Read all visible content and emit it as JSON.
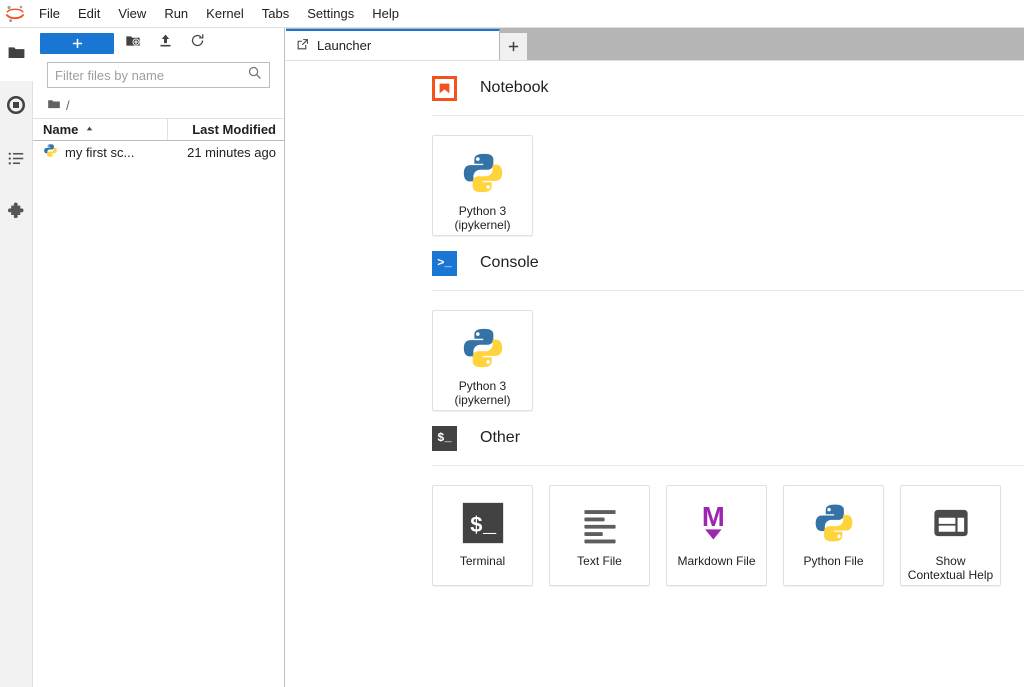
{
  "app": {
    "logo_icon": "jupyter-logo",
    "accent_blue": "#1976d2",
    "notebook_orange": "#f4511e",
    "markdown_purple": "#9c27b0",
    "tabbar_gray": "#b5b5b5"
  },
  "menubar": {
    "items": [
      {
        "label": "File"
      },
      {
        "label": "Edit"
      },
      {
        "label": "View"
      },
      {
        "label": "Run"
      },
      {
        "label": "Kernel"
      },
      {
        "label": "Tabs"
      },
      {
        "label": "Settings"
      },
      {
        "label": "Help"
      }
    ]
  },
  "activitybar": {
    "items": [
      {
        "name": "file-browser",
        "icon": "folder-icon",
        "active": true
      },
      {
        "name": "running-sessions",
        "icon": "running-circle-icon",
        "active": false
      },
      {
        "name": "command-palette",
        "icon": "list-icon",
        "active": false
      },
      {
        "name": "extension-manager",
        "icon": "puzzle-piece-icon",
        "active": false
      }
    ]
  },
  "filebrowser": {
    "toolbar": {
      "new_launcher_label": "+",
      "new_folder_icon": "new-folder-icon",
      "upload_icon": "upload-icon",
      "refresh_icon": "refresh-icon"
    },
    "filter": {
      "placeholder": "Filter files by name",
      "value": "",
      "icon": "search-icon"
    },
    "breadcrumb": {
      "root_icon": "folder-icon",
      "path": "/"
    },
    "columns": {
      "name": "Name",
      "last_modified": "Last Modified",
      "sort_icon": "caret-up-icon"
    },
    "files": [
      {
        "name": "my first sc...",
        "icon": "python-file-icon",
        "last_modified": "21 minutes ago"
      }
    ]
  },
  "tabbar": {
    "tabs": [
      {
        "label": "Launcher",
        "icon": "launcher-icon",
        "active": true
      }
    ],
    "add_tab_label": "+"
  },
  "launcher": {
    "sections": [
      {
        "id": "notebook",
        "title": "Notebook",
        "icon": "notebook-bookmark-icon",
        "cards": [
          {
            "label": "Python 3\n(ipykernel)",
            "icon": "python-logo-icon"
          }
        ]
      },
      {
        "id": "console",
        "title": "Console",
        "icon": "console-prompt-icon",
        "icon_text": ">_",
        "cards": [
          {
            "label": "Python 3\n(ipykernel)",
            "icon": "python-logo-icon"
          }
        ]
      },
      {
        "id": "other",
        "title": "Other",
        "icon": "terminal-dollar-icon",
        "icon_text": "$_",
        "cards": [
          {
            "label": "Terminal",
            "icon": "terminal-dollar-icon"
          },
          {
            "label": "Text File",
            "icon": "text-lines-icon"
          },
          {
            "label": "Markdown File",
            "icon": "markdown-m-icon"
          },
          {
            "label": "Python File",
            "icon": "python-logo-icon"
          },
          {
            "label": "Show\nContextual Help",
            "icon": "contextual-help-panels-icon"
          }
        ]
      }
    ]
  }
}
